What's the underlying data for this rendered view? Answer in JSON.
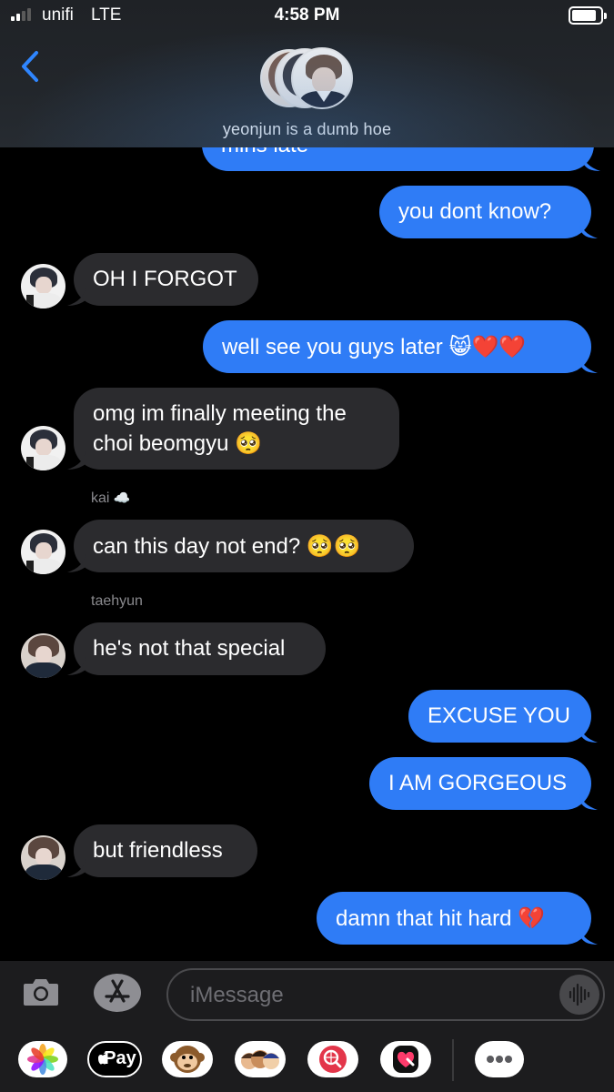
{
  "status_bar": {
    "carrier": "unifi",
    "network": "LTE",
    "time": "4:58 PM",
    "signal_bars": 4,
    "signal_bars_active": 2
  },
  "header": {
    "group_name": "yeonjun is a dumb hoe",
    "back_icon": "chevron-left-icon"
  },
  "messages": [
    {
      "direction": "out",
      "text": "mins late",
      "partial": true
    },
    {
      "direction": "out",
      "text": "you dont know?"
    },
    {
      "direction": "in",
      "text": "OH I FORGOT"
    },
    {
      "direction": "out",
      "text": "well see you guys later",
      "emoji": "😸❤️❤️"
    },
    {
      "direction": "in",
      "text": "omg im finally meeting the choi beomgyu",
      "emoji": "🥺"
    },
    {
      "direction": "in",
      "sender": "kai",
      "sender_emoji": "☁️",
      "text": "can this day not end?",
      "emoji": "🥺🥺"
    },
    {
      "direction": "in",
      "sender": "taehyun",
      "text": "he's not that special"
    },
    {
      "direction": "out",
      "text": "EXCUSE YOU"
    },
    {
      "direction": "out",
      "text": "I AM GORGEOUS"
    },
    {
      "direction": "in",
      "text": "but friendless"
    },
    {
      "direction": "out",
      "text": "damn that hit hard",
      "emoji": "💔"
    }
  ],
  "input": {
    "placeholder": "iMessage",
    "camera_icon": "camera-icon",
    "apps_icon": "app-store-icon",
    "audio_icon": "audio-waveform-icon"
  },
  "app_drawer": {
    "items": [
      {
        "name": "photos-icon",
        "label": ""
      },
      {
        "name": "apple-pay-icon",
        "label": "Pay"
      },
      {
        "name": "animoji-icon",
        "label": ""
      },
      {
        "name": "memoji-icon",
        "label": ""
      },
      {
        "name": "web-images-icon",
        "label": ""
      },
      {
        "name": "digital-touch-icon",
        "label": ""
      },
      {
        "name": "more-icon",
        "label": ""
      }
    ]
  },
  "colors": {
    "outgoing_bubble": "#2f7cf6",
    "incoming_bubble": "#2b2b2e",
    "background": "#000000",
    "header": "#22262b"
  }
}
